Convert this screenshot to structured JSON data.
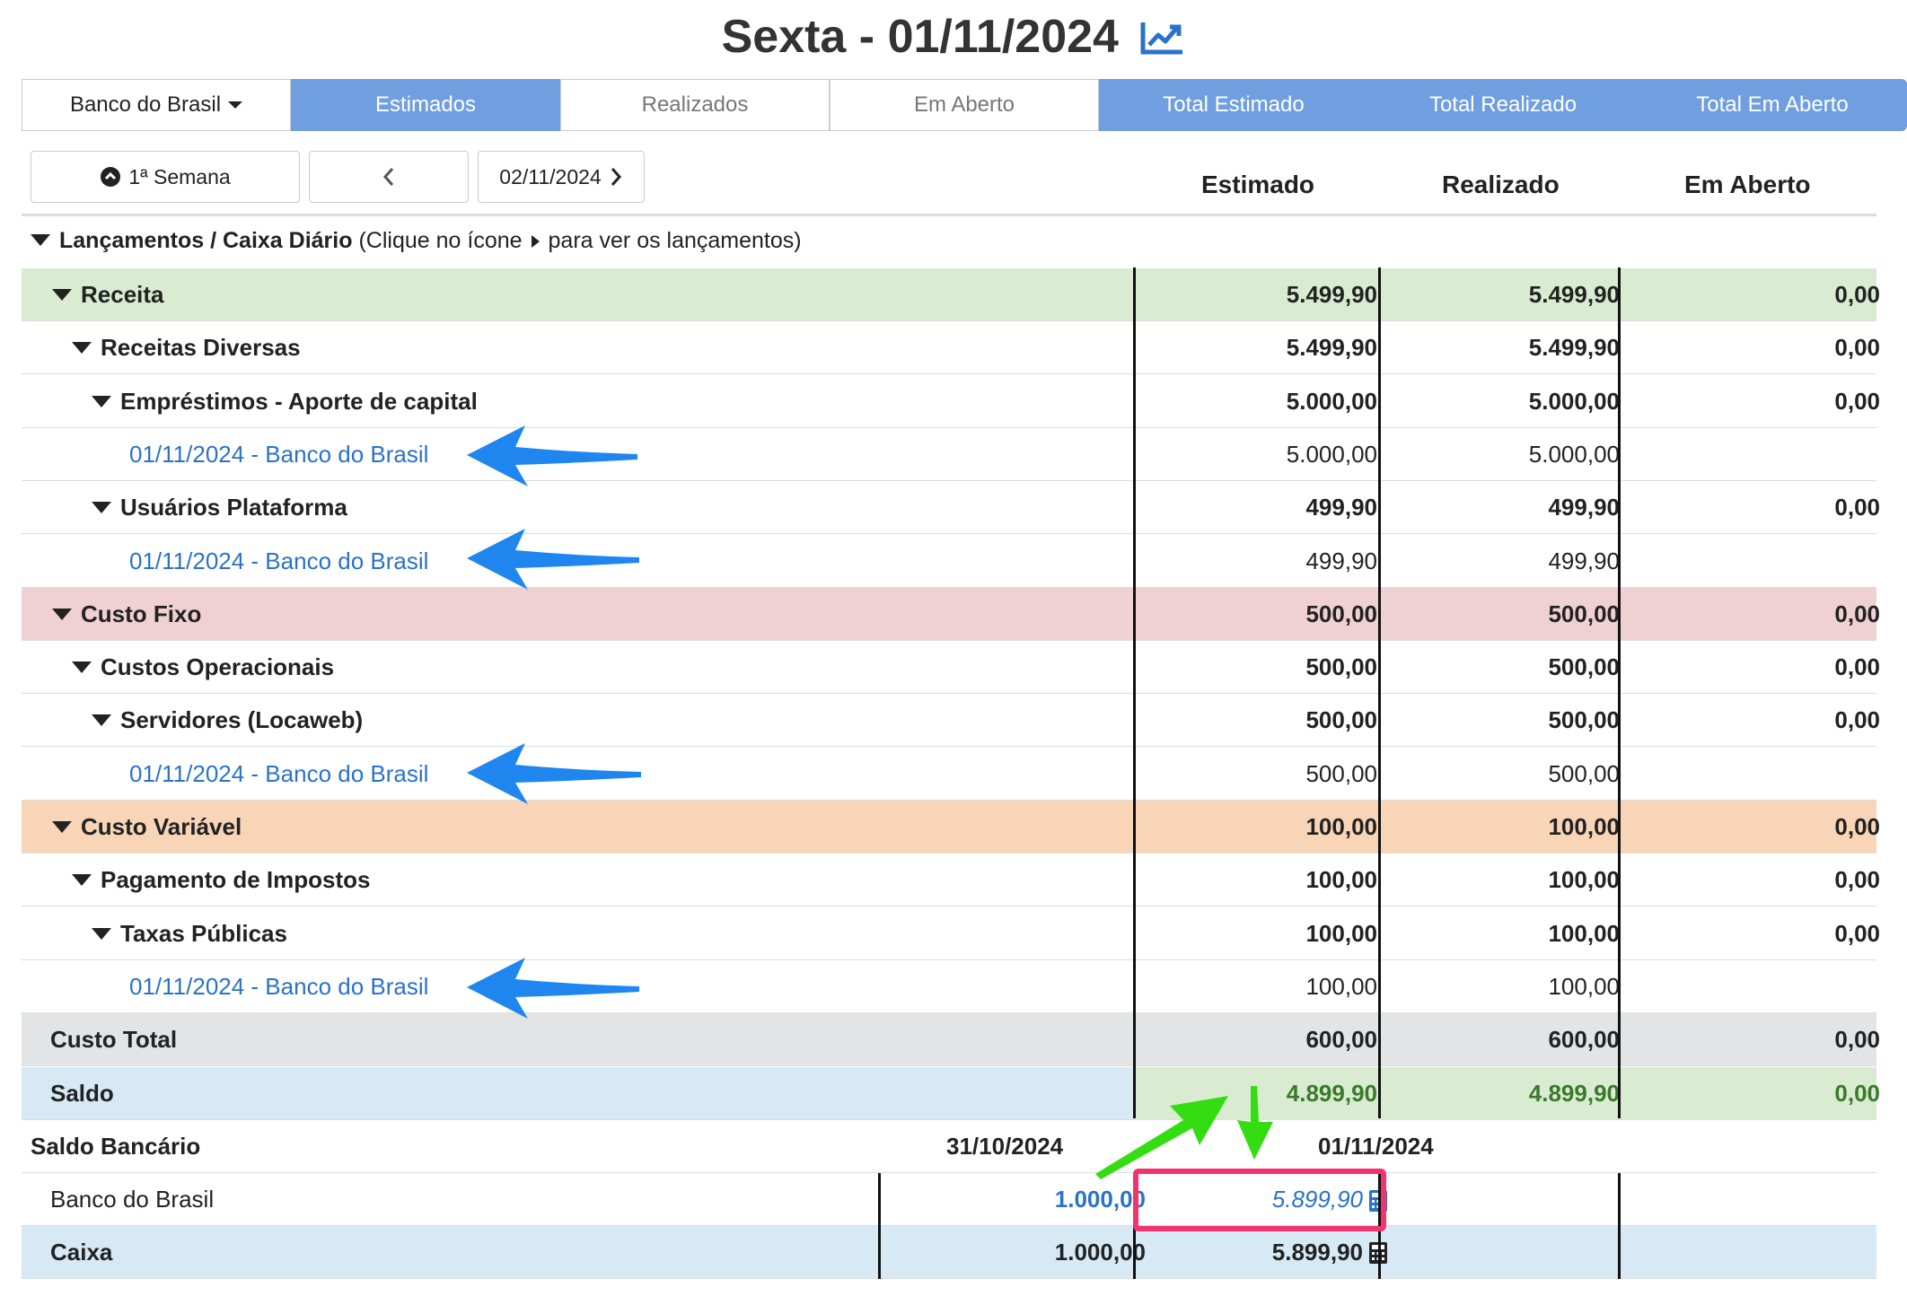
{
  "title": "Sexta - 01/11/2024",
  "tabs": {
    "bank": "Banco do Brasil",
    "estimados": "Estimados",
    "realizados": "Realizados",
    "em_aberto": "Em Aberto",
    "total_estimado": "Total Estimado",
    "total_realizado": "Total Realizado",
    "total_em_aberto": "Total Em Aberto"
  },
  "nav": {
    "week": "1ª Semana",
    "next_date": "02/11/2024"
  },
  "columns": {
    "estimado": "Estimado",
    "realizado": "Realizado",
    "em_aberto": "Em Aberto"
  },
  "section": {
    "title": "Lançamentos / Caixa Diário",
    "hint_prefix": "(Clique no ícone",
    "hint_suffix": "para ver os lançamentos)"
  },
  "rows": [
    {
      "label": "Receita",
      "est": "5.499,90",
      "real": "5.499,90",
      "open": "0,00"
    },
    {
      "label": "Receitas Diversas",
      "est": "5.499,90",
      "real": "5.499,90",
      "open": "0,00"
    },
    {
      "label": "Empréstimos - Aporte de capital",
      "est": "5.000,00",
      "real": "5.000,00",
      "open": "0,00"
    },
    {
      "label": "01/11/2024 - Banco do Brasil",
      "est": "5.000,00",
      "real": "5.000,00",
      "open": ""
    },
    {
      "label": "Usuários Plataforma",
      "est": "499,90",
      "real": "499,90",
      "open": "0,00"
    },
    {
      "label": "01/11/2024 - Banco do Brasil",
      "est": "499,90",
      "real": "499,90",
      "open": ""
    },
    {
      "label": "Custo Fixo",
      "est": "500,00",
      "real": "500,00",
      "open": "0,00"
    },
    {
      "label": "Custos Operacionais",
      "est": "500,00",
      "real": "500,00",
      "open": "0,00"
    },
    {
      "label": "Servidores (Locaweb)",
      "est": "500,00",
      "real": "500,00",
      "open": "0,00"
    },
    {
      "label": "01/11/2024 - Banco do Brasil",
      "est": "500,00",
      "real": "500,00",
      "open": ""
    },
    {
      "label": "Custo Variável",
      "est": "100,00",
      "real": "100,00",
      "open": "0,00"
    },
    {
      "label": "Pagamento de Impostos",
      "est": "100,00",
      "real": "100,00",
      "open": "0,00"
    },
    {
      "label": "Taxas Públicas",
      "est": "100,00",
      "real": "100,00",
      "open": "0,00"
    },
    {
      "label": "01/11/2024 - Banco do Brasil",
      "est": "100,00",
      "real": "100,00",
      "open": ""
    },
    {
      "label": "Custo Total",
      "est": "600,00",
      "real": "600,00",
      "open": "0,00"
    },
    {
      "label": "Saldo",
      "est": "4.899,90",
      "real": "4.899,90",
      "open": "0,00"
    }
  ],
  "bank_balance": {
    "title": "Saldo Bancário",
    "date_prev": "31/10/2024",
    "date_curr": "01/11/2024",
    "bank_label": "Banco do Brasil",
    "bank_prev": "1.000,00",
    "bank_curr": "5.899,90",
    "cash_label": "Caixa",
    "cash_prev": "1.000,00",
    "cash_curr": "5.899,90"
  },
  "colors": {
    "tab_active": "#6f9fe0",
    "link": "#2a72c8",
    "receita_bg": "#d9ecd2",
    "custo_fixo_bg": "#efd0d3",
    "custo_variavel_bg": "#f9d5b8",
    "custo_total_bg": "#e3e4e6",
    "saldo_bg": "#d6e9f4",
    "annotation_arrow_blue": "#1f86f0",
    "annotation_arrow_green": "#33dd11",
    "annotation_box": "#f2346e"
  }
}
